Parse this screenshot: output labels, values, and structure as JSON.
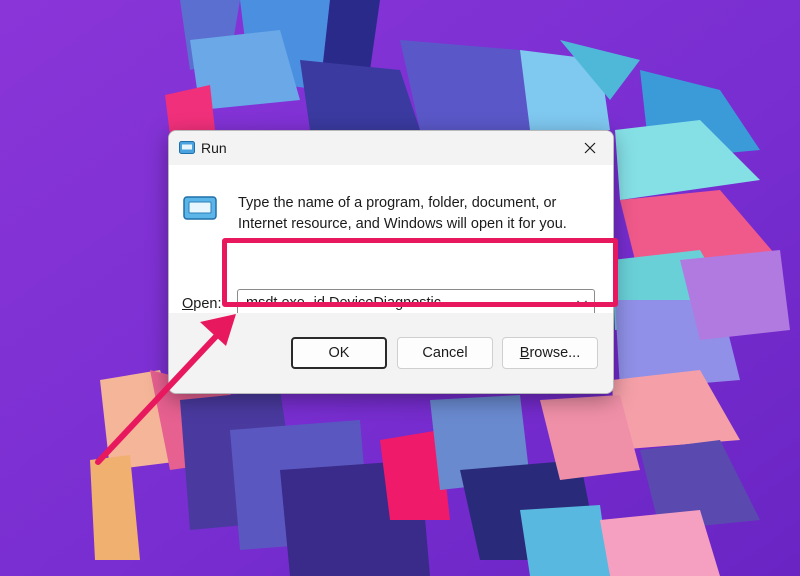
{
  "window": {
    "title": "Run"
  },
  "prompt": {
    "line1": "Type the name of a program, folder, document, or",
    "line2": "Internet resource, and Windows will open it for you."
  },
  "open": {
    "label_prefix": "",
    "label_accel": "O",
    "label_suffix": "pen:",
    "value": "msdt.exe -id DeviceDiagnostic"
  },
  "buttons": {
    "ok": "OK",
    "cancel": "Cancel",
    "browse_accel": "B",
    "browse_suffix": "rowse..."
  },
  "colors": {
    "annotation": "#e8185f",
    "accent": "#005fb8",
    "wallpaper": "#7a2ed0"
  },
  "icons": [
    "run-icon",
    "close-icon",
    "run-large-icon",
    "chevron-down-icon"
  ]
}
